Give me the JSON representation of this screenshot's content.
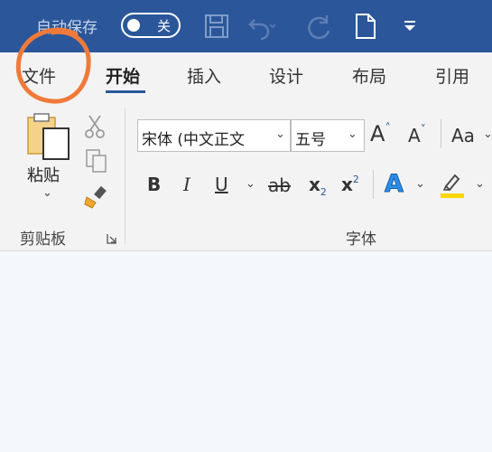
{
  "titlebar": {
    "autosave_label": "自动保存",
    "autosave_state": "关",
    "background": "#2b579a"
  },
  "tabs": [
    {
      "label": "文件",
      "active": false
    },
    {
      "label": "开始",
      "active": true
    },
    {
      "label": "插入",
      "active": false
    },
    {
      "label": "设计",
      "active": false
    },
    {
      "label": "布局",
      "active": false
    },
    {
      "label": "引用",
      "active": false
    }
  ],
  "clipboard": {
    "paste_label": "粘贴",
    "group_label": "剪贴板"
  },
  "font": {
    "font_name": "宋体 (中文正文",
    "font_size": "五号",
    "grow_label": "A",
    "shrink_label": "A",
    "case_label": "Aa",
    "bold": "B",
    "italic": "I",
    "underline": "U",
    "strike": "ab",
    "subscript": "x",
    "sub_mark": "2",
    "superscript": "x",
    "sup_mark": "2",
    "text_effect": "A",
    "group_label": "字体",
    "highlight_color": "#ffd700",
    "effect_color": "#2a8ee8"
  },
  "annotation_color": "#f07a3a"
}
